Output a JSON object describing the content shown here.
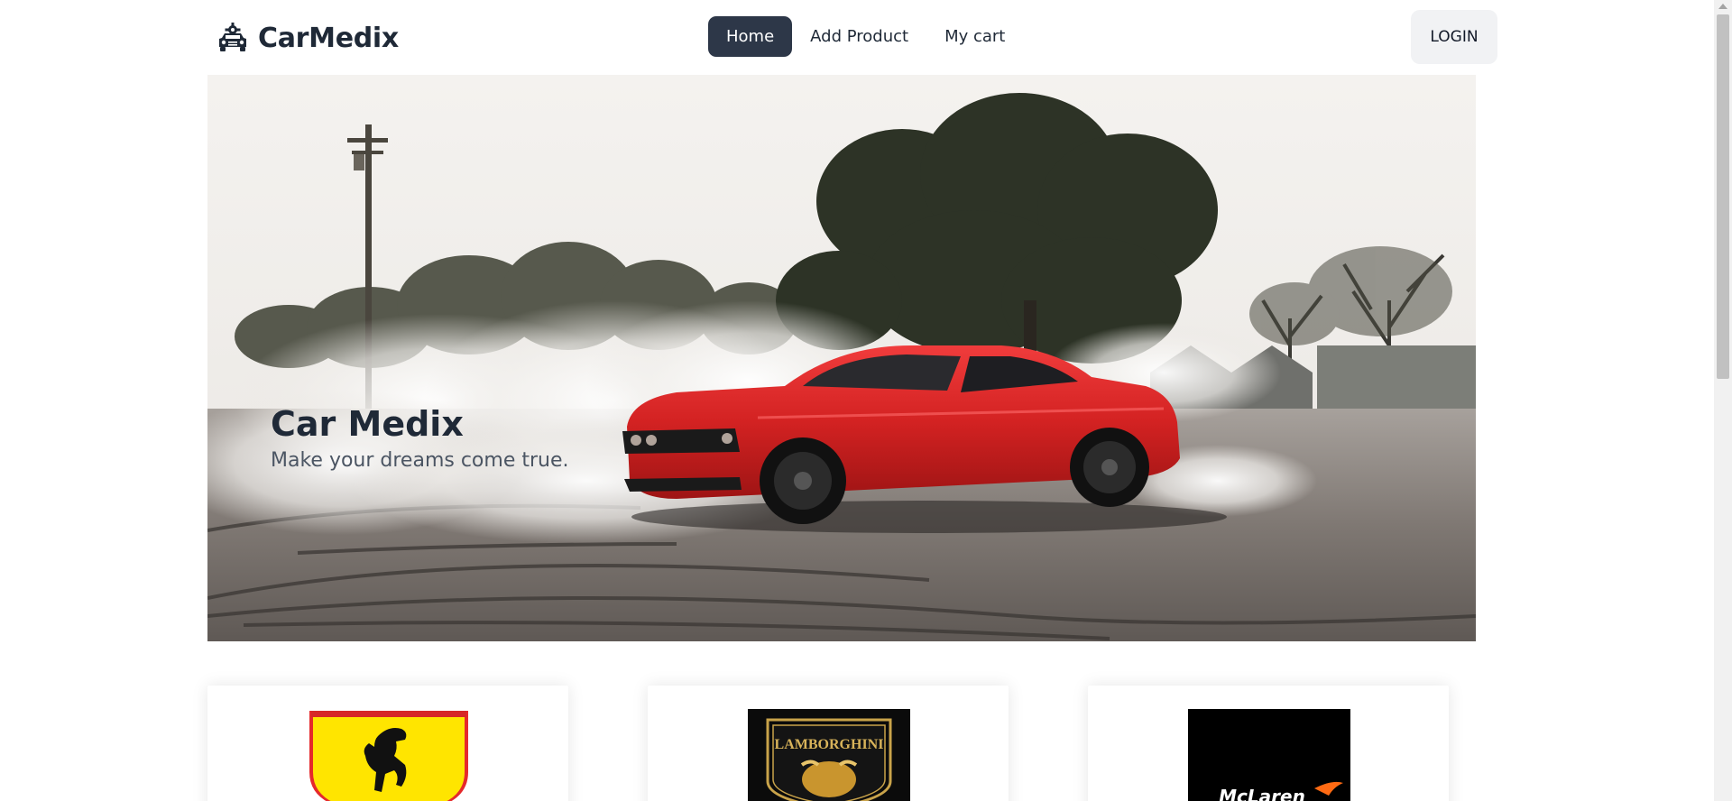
{
  "header": {
    "brand_name": "CarMedix",
    "brand_icon": "car-wrench-icon",
    "nav": [
      {
        "label": "Home",
        "active": true
      },
      {
        "label": "Add Product",
        "active": false
      },
      {
        "label": "My cart",
        "active": false
      }
    ],
    "login_label": "LOGIN"
  },
  "hero": {
    "title": "Car Medix",
    "subtitle": "Make your dreams come true.",
    "image": "red-muscle-car-drifting-photo"
  },
  "brands": [
    {
      "name": "Ferrari",
      "logo": "ferrari-logo"
    },
    {
      "name": "Lamborghini",
      "logo_text": "LAMBORGHINI",
      "logo": "lamborghini-logo"
    },
    {
      "name": "McLaren",
      "logo_text": "McLaren",
      "logo": "mclaren-logo"
    }
  ],
  "colors": {
    "nav_active_bg": "#2d3748",
    "text_dark": "#1f2937",
    "car_red": "#d32222"
  }
}
